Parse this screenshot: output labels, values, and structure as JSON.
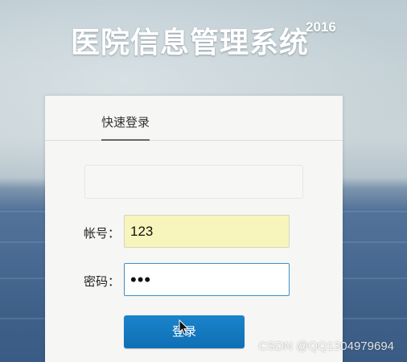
{
  "header": {
    "title": "医院信息管理系统",
    "year": "2016"
  },
  "login": {
    "tab_label": "快速登录",
    "message": "",
    "username_label": "帐号：",
    "username_value": "123",
    "password_label": "密码：",
    "password_value": "•••",
    "submit_label": "登录"
  },
  "watermark": {
    "text": "CSDN @QQ1304979694"
  },
  "colors": {
    "button": "#0f6fb4",
    "autofill": "#f8f5bc",
    "focus_border": "#3c8fc9",
    "panel": "#f6f6f4"
  },
  "icons": {
    "cursor": "mouse-pointer-icon"
  }
}
